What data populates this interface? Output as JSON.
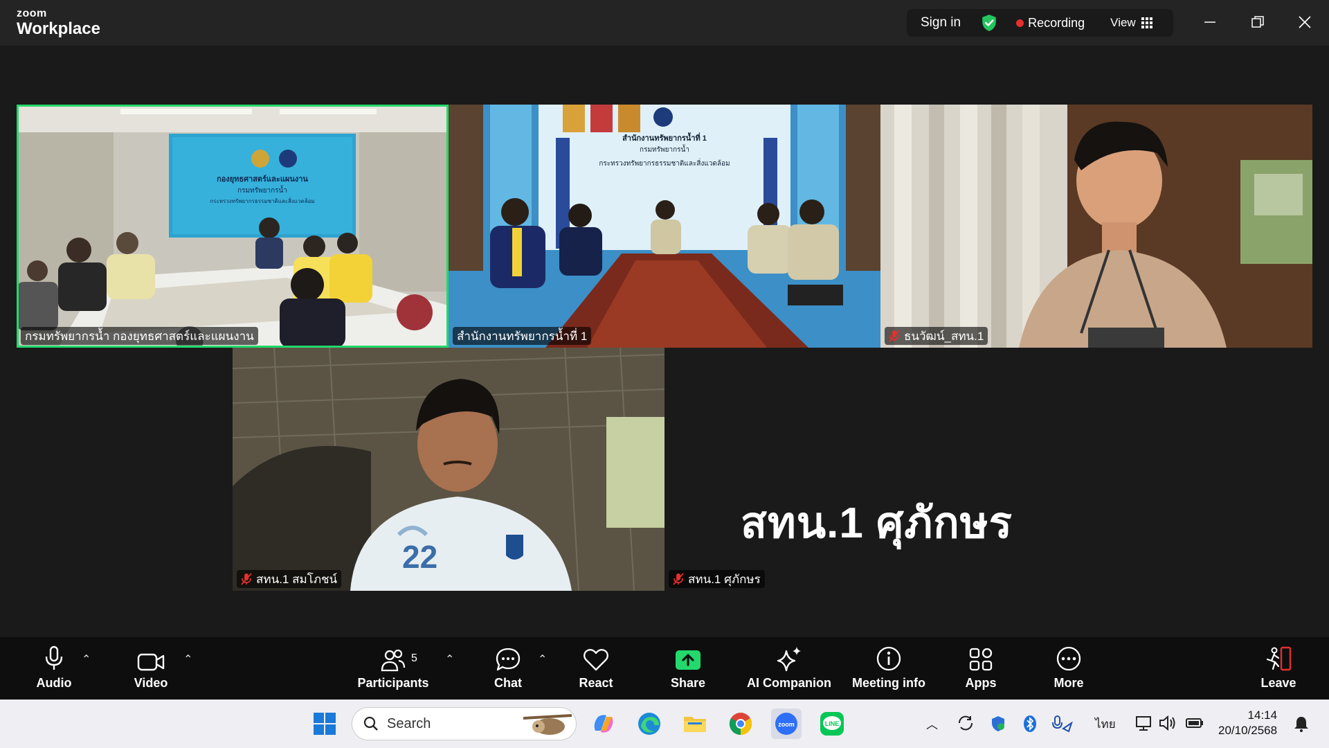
{
  "app": {
    "brand_small": "zoom",
    "brand_large": "Workplace"
  },
  "topbar": {
    "sign_in": "Sign in",
    "recording": "Recording",
    "view": "View"
  },
  "tiles": [
    {
      "name": "กรมทรัพยากรน้ำ กองยุทธศาสตร์และแผนงาน",
      "muted": false,
      "active": true
    },
    {
      "name": "สำนักงานทรัพยากรน้ำที่ 1",
      "muted": false,
      "active": false
    },
    {
      "name": "ธนวัฒน์_สทน.1",
      "muted": true,
      "active": false
    },
    {
      "name": "สทน.1  สมโภชน์",
      "muted": true,
      "active": false
    },
    {
      "name": "สทน.1 ศุภักษร",
      "muted": true,
      "active": false,
      "no_video_name": "สทน.1 ศุภักษร"
    }
  ],
  "slides": {
    "tile1_sign": [
      "กองยุทธศาสตร์และแผนงาน",
      "กรมทรัพยากรน้ำ",
      "กระทรวงทรัพยากรธรรมชาติและสิ่งแวดล้อม"
    ],
    "tile2_sign": [
      "สำนักงานทรัพยากรน้ำที่ 1",
      "กรมทรัพยากรน้ำ",
      "กระทรวงทรัพยากรธรรมชาติและสิ่งแวดล้อม"
    ],
    "jersey_number": "22"
  },
  "toolbar": {
    "audio": "Audio",
    "video": "Video",
    "participants": "Participants",
    "participants_count": "5",
    "chat": "Chat",
    "react": "React",
    "share": "Share",
    "ai_companion": "AI Companion",
    "meeting_info": "Meeting info",
    "apps": "Apps",
    "more": "More",
    "leave": "Leave"
  },
  "taskbar": {
    "search_placeholder": "Search",
    "language": "ไทย",
    "time": "14:14",
    "date": "20/10/2568"
  },
  "colors": {
    "active_speaker": "#23d96b",
    "share_green": "#23d96b",
    "leave_red": "#e5302c",
    "recording_dot": "#e5302c"
  }
}
